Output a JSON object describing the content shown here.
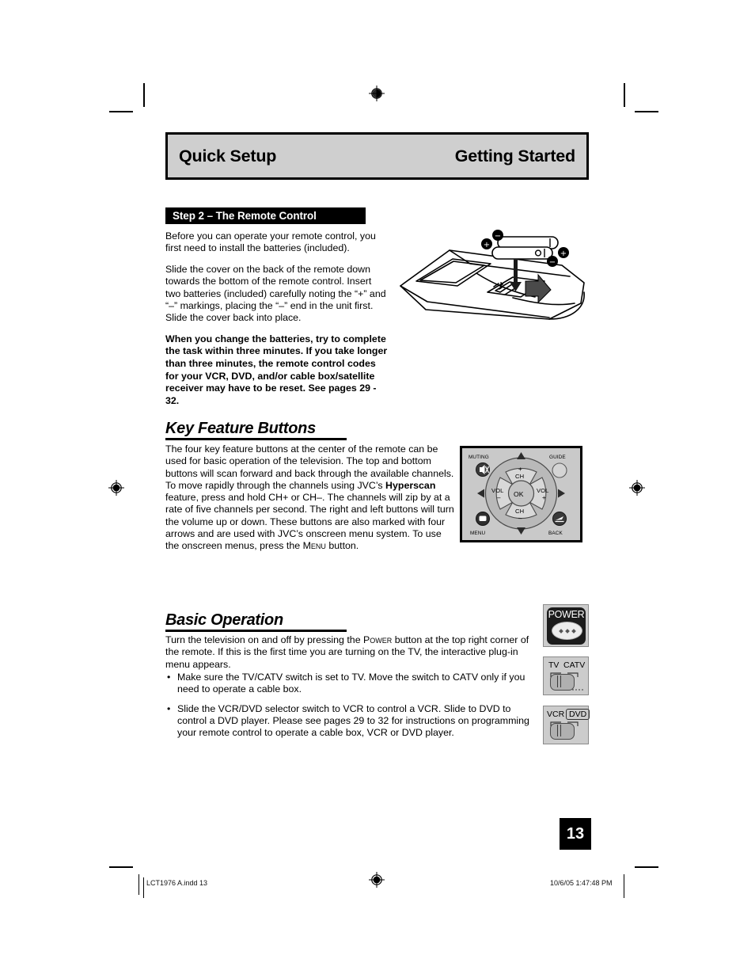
{
  "header": {
    "left_title": "Quick Setup",
    "right_title": "Getting Started"
  },
  "step_bar": {
    "label": "Step 2 – The Remote Control"
  },
  "intro": {
    "paragraph_1": "Before you can operate your remote control, you first need to install the batteries (included).",
    "paragraph_2": "Slide the cover on the back of the remote down towards the bottom of the remote control. Insert two batteries (included) carefully noting the “+” and “–” markings, placing the “–” end in the unit first. Slide the cover back into place.",
    "paragraph_3_bold": "When you change the batteries, try to complete the task within three minutes. If you take longer than three minutes, the remote control codes for your VCR, DVD, and/or cable box/satellite receiver may have to be reset. See pages 29 - 32."
  },
  "battery_figure": {
    "plus_label_1": "+",
    "minus_label_1": "–",
    "plus_label_2": "+",
    "minus_label_2": "–"
  },
  "key_feature": {
    "heading": "Key Feature Buttons",
    "body_part_1": "The four key feature buttons at the center of the remote can be used for basic operation of the television. The top and bottom buttons will scan forward and back through the available channels. To move rapidly through the channels using JVC’s ",
    "bold_term": "Hyperscan",
    "body_part_2": " feature, press and hold CH+ or CH–. The channels will zip by at a rate of five channels per second. The right and left buttons will turn the volume up or down. These buttons are also marked with four arrows and are used with JVC’s onscreen menu system. To use the onscreen menus, press the ",
    "menu_smallcaps": "Menu",
    "body_part_3": " button."
  },
  "keypad": {
    "muting_label": "MUTING",
    "guide_label": "GUIDE",
    "menu_label": "MENU",
    "back_label": "BACK",
    "ch_up_plus": "+",
    "ch_up_label": "CH",
    "ch_down_label": "CH",
    "ch_down_minus": "–",
    "vol_left_label": "VOL",
    "vol_left_minus": "–",
    "vol_right_label": "VOL",
    "vol_right_plus": "+",
    "ok_label": "OK"
  },
  "basic_operation": {
    "heading": "Basic Operation",
    "intro_part_1": "Turn the television on and off by pressing the ",
    "power_smallcaps": "Power",
    "intro_part_2": " button at the top right corner of the remote.  If this is the first time you are turning on the TV, the interactive plug-in menu appears.",
    "bullets": [
      "Make sure the TV/CATV switch is set to TV. Move the switch to CATV only if you need to operate a cable box.",
      "Slide the VCR/DVD selector switch to VCR to control a VCR. Slide to DVD to control a DVD player. Please see pages 29 to 32 for instructions on programming your remote control to operate a cable box, VCR or DVD player."
    ]
  },
  "switch_figures": {
    "power_label": "POWER",
    "tv_label": "TV",
    "catv_label": "CATV",
    "vcr_label": "VCR",
    "dvd_label": "DVD"
  },
  "page_badge": {
    "number": "13"
  },
  "footer": {
    "file_name": "LCT1976 A.indd   13",
    "timestamp": "10/6/05   1:47:48 PM"
  },
  "colors": {
    "header_bar_fill": "#cfcfcf",
    "step_bar_fill": "#000000",
    "figure_panel_fill": "#c9c9c9",
    "switch_panel_fill": "#cccccc"
  }
}
